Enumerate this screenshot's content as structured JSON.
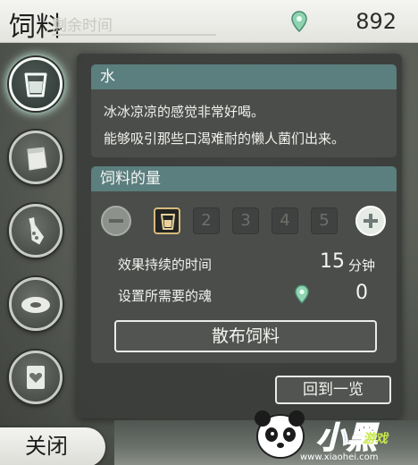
{
  "header": {
    "title": "饲料",
    "ghost_text": "剩余时间",
    "currency_icon": "pin-icon",
    "currency_value": "892"
  },
  "tabs": [
    {
      "icon": "cup-icon",
      "active": true
    },
    {
      "icon": "feed-bag-icon",
      "active": false
    },
    {
      "icon": "bottle-icon",
      "active": false
    },
    {
      "icon": "disc-icon",
      "active": false
    },
    {
      "icon": "heart-card-icon",
      "active": false
    }
  ],
  "item": {
    "name": "水",
    "description_lines": [
      "冰冰凉凉的感觉非常好喝。",
      "能够吸引那些口渴难耐的懒人菌们出来。"
    ]
  },
  "amount": {
    "title": "饲料的量",
    "steps": [
      "1",
      "2",
      "3",
      "4",
      "5"
    ],
    "selected": 1,
    "duration_label": "效果持续的时间",
    "duration_value": "15",
    "duration_unit": "分钟",
    "souls_label": "设置所需要的魂",
    "souls_value": "0"
  },
  "buttons": {
    "spread": "散布饲料",
    "back": "回到一览",
    "close": "关闭"
  },
  "watermark": {
    "main": "小黑",
    "sub": "游戏",
    "url": "www.xiaohei.com"
  },
  "colors": {
    "section_header": "#5b7e7e",
    "panel": "#3a3c3a",
    "selected_border": "#d6ba7c",
    "pin_icon": "#8fd3b0"
  }
}
